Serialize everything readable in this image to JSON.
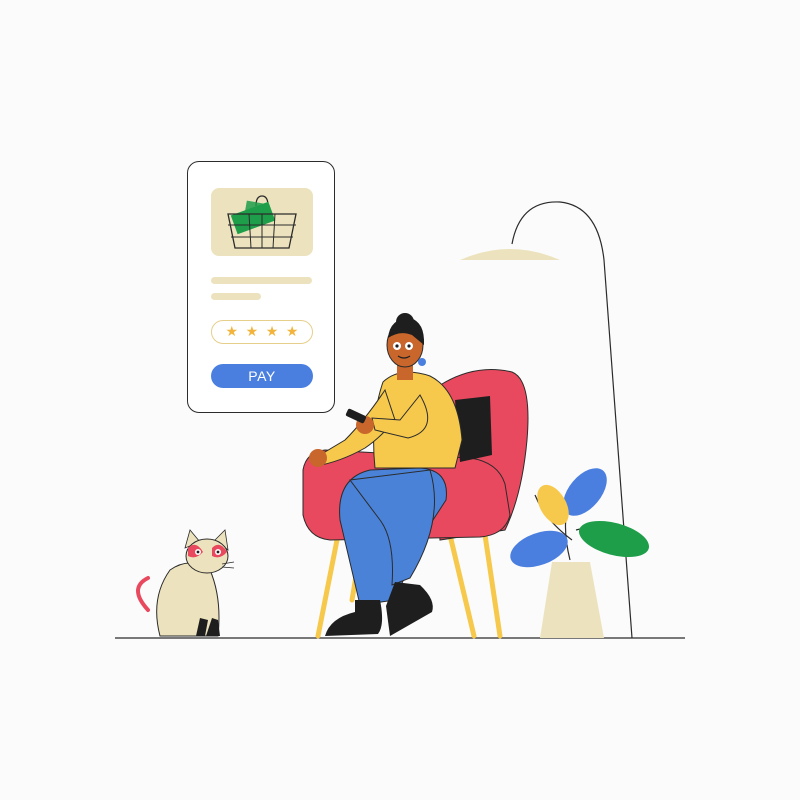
{
  "payment_card": {
    "pay_label": "PAY",
    "rating": {
      "value": 4,
      "max": 4
    },
    "product_icon": "shopping-basket-icon"
  },
  "colors": {
    "background": "#fbfbfb",
    "accent_blue": "#4a7fe0",
    "armchair_red": "#e9495e",
    "sweater_yellow": "#f6c94d",
    "pants_blue": "#4a82d8",
    "money_green": "#1f9e4a",
    "beige": "#ece3be",
    "star_gold": "#f2b43c",
    "leaf_green": "#1f9e4a",
    "leaf_blue": "#4a7fe0"
  }
}
